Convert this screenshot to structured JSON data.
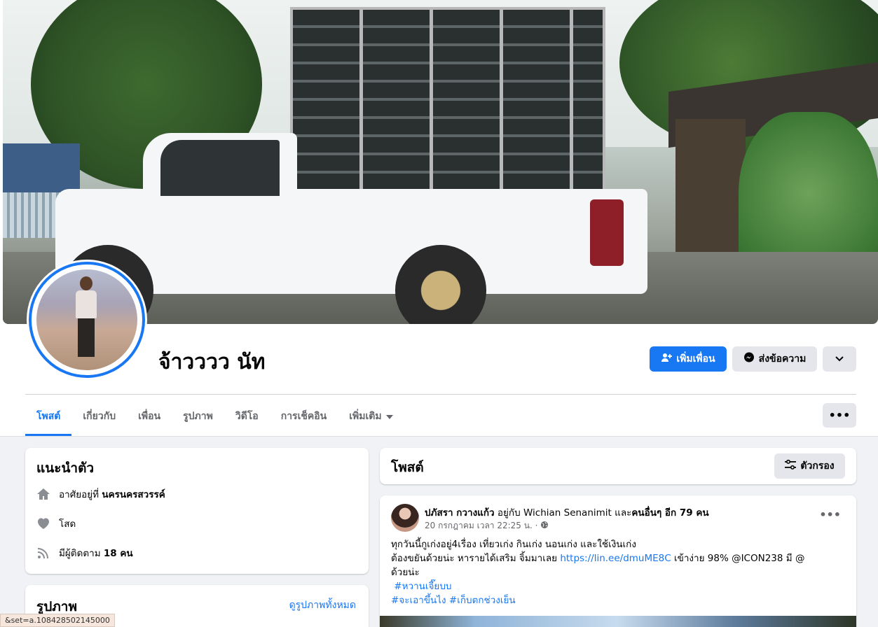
{
  "profile": {
    "name": "จ้าวววว นัท",
    "add_friend_label": "เพิ่มเพื่อน",
    "message_label": "ส่งข้อความ"
  },
  "tabs": [
    {
      "label": "โพสต์",
      "active": true
    },
    {
      "label": "เกี่ยวกับ"
    },
    {
      "label": "เพื่อน"
    },
    {
      "label": "รูปภาพ"
    },
    {
      "label": "วิดีโอ"
    },
    {
      "label": "การเช็คอิน"
    },
    {
      "label": "เพิ่มเติม"
    }
  ],
  "intro": {
    "title": "แนะนำตัว",
    "lives_prefix": "อาศัยอยู่ที่ ",
    "lives_place": "นครนครสวรรค์",
    "relationship": "โสด",
    "followers_prefix": "มีผู้ติดตาม ",
    "followers_count": "18 คน"
  },
  "photos": {
    "title": "รูปภาพ",
    "see_all": "ดูรูปภาพทั้งหมด"
  },
  "posts_section": {
    "title": "โพสต์",
    "filter_label": "ตัวกรอง"
  },
  "post": {
    "author": "ปภัสรา กวางแก้ว",
    "with_text": " อยู่กับ ",
    "with_person": "Wichian Senanimit",
    "and_text": " และ",
    "others": "คนอื่นๆ อีก 79 คน",
    "timestamp": "20 กรกฎาคม เวลา 22:25 น. ·",
    "line1": "ทุกวันนี้กูเก่งอยู่4เรื่อง เที่ยวเก่ง กินเก่ง นอนเก่ง และใช้เงินเก่ง",
    "line2_pre": "ต้องขยันด้วยน่ะ หารายได้เสริม  จิ้มมาเลย  ",
    "line2_link": "https://lin.ee/dmuME8C",
    "line2_post": "  เข้าง่าย  98%   @ICON238  มี @",
    "line3": "ด้วยน่ะ",
    "hashtag1": "#หวานเจี๊ยบบ",
    "hashtag2": "#จะเอาขึ้นไง",
    "hashtag3": "#เก็บตกช่วงเย็น"
  },
  "status_bar": "&set=a.108428502145000",
  "colors": {
    "accent": "#1877f2",
    "background": "#f0f2f5",
    "button_gray": "#e4e6eb"
  }
}
